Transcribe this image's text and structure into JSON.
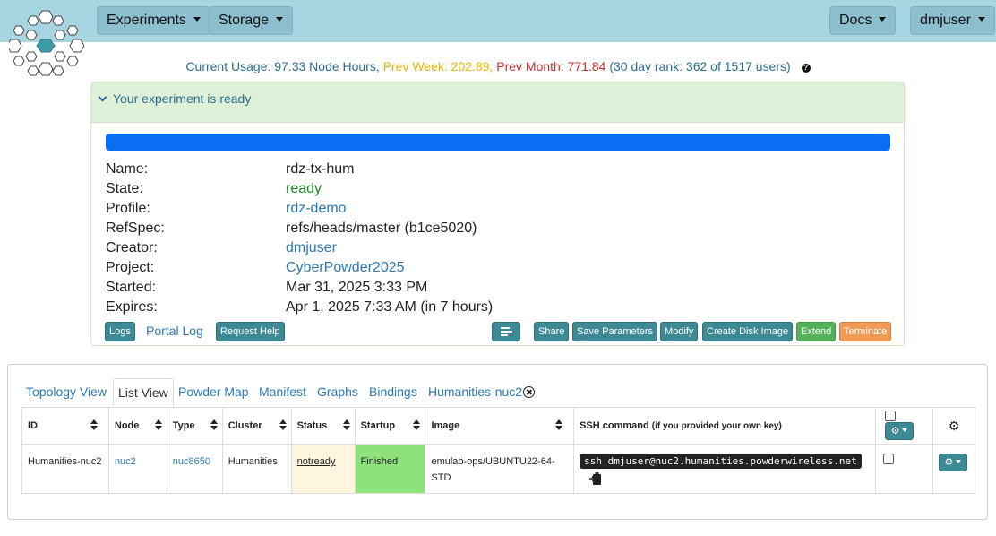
{
  "nav": {
    "experiments_label": "Experiments",
    "storage_label": "Storage",
    "docs_label": "Docs",
    "user_label": "dmjuser"
  },
  "usage": {
    "current": "Current Usage: 97.33 Node Hours,",
    "prev_week": "Prev Week: 202.89,",
    "prev_month": "Prev Month: 771.84",
    "rank": "(30 day rank: 362 of 1517 users)",
    "help_glyph": "?"
  },
  "experiment": {
    "status_heading": "Your experiment is ready",
    "progress_fraction": 1.0,
    "fields": {
      "name_label": "Name:",
      "name": "rdz-tx-hum",
      "state_label": "State:",
      "state": "ready",
      "profile_label": "Profile:",
      "profile": "rdz-demo",
      "refspec_label": "RefSpec:",
      "refspec": "refs/heads/master (b1ce5020)",
      "creator_label": "Creator:",
      "creator": "dmjuser",
      "project_label": "Project:",
      "project": "CyberPowder2025",
      "started_label": "Started:",
      "started": "Mar 31, 2025 3:33 PM",
      "expires_label": "Expires:",
      "expires": "Apr 1, 2025 7:33 AM (in 7 hours)"
    },
    "buttons": {
      "logs": "Logs",
      "portal_log": "Portal Log",
      "request_help": "Request Help",
      "share": "Share",
      "save_parameters": "Save Parameters",
      "modify": "Modify",
      "create_disk_image": "Create Disk Image",
      "extend": "Extend",
      "terminate": "Terminate"
    }
  },
  "tabs": [
    {
      "label": "Topology View"
    },
    {
      "label": "List View"
    },
    {
      "label": "Powder Map"
    },
    {
      "label": "Manifest"
    },
    {
      "label": "Graphs"
    },
    {
      "label": "Bindings"
    },
    {
      "label": "Humanities-nuc2"
    }
  ],
  "table": {
    "headers": {
      "id": "ID",
      "node": "Node",
      "type": "Type",
      "cluster": "Cluster",
      "status": "Status",
      "startup": "Startup",
      "image": "Image",
      "ssh": "SSH command",
      "ssh_note": "(if you provided your own key)"
    },
    "rows": [
      {
        "id": "Humanities-nuc2",
        "node": "nuc2",
        "type": "nuc8650",
        "cluster": "Humanities",
        "status": "notready",
        "startup": "Finished",
        "image": "emulab-ops/UBUNTU22-64-STD",
        "ssh": "ssh dmjuser@nuc2.humanities.powderwireless.net"
      }
    ]
  },
  "colors": {
    "navbar": "#a8d5e2",
    "accent_teal": "#3d8a96",
    "panel_header": "#dff0d8",
    "progress": "#0a6ff2",
    "link": "#2a7ab7",
    "extend": "#55b05a",
    "terminate": "#f19a55",
    "finished_cell": "#8ee27c",
    "notready_cell": "#fdf5dd"
  },
  "icons": {
    "logo": "snowflake-hexagon-logo",
    "collapse": "chevron-down-icon",
    "list": "list-icon",
    "gear": "gear-icon",
    "copy": "clipboard-icon",
    "close_tab": "close-circle-icon",
    "help": "question-circle-icon"
  }
}
